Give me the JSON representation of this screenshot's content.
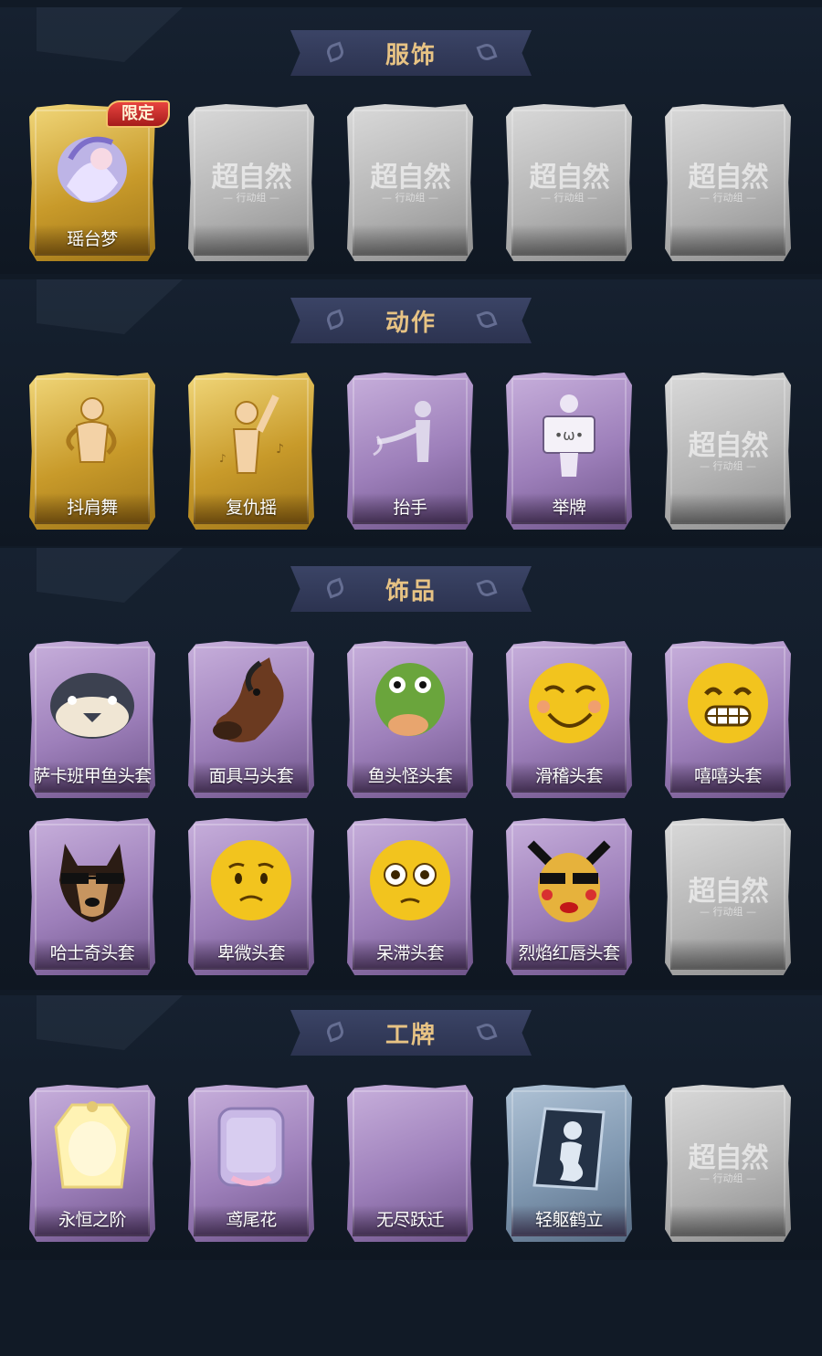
{
  "sections": [
    {
      "title": "服饰",
      "cards": [
        {
          "label": "瑶台梦",
          "rarity": "gold",
          "icon": "costume-portrait-icon",
          "badge": "限定"
        },
        {
          "label": "",
          "rarity": "gray",
          "icon": "locked-placeholder-icon",
          "locked_text": "超自然",
          "locked_sub": "— 行动组 —"
        },
        {
          "label": "",
          "rarity": "gray",
          "icon": "locked-placeholder-icon",
          "locked_text": "超自然",
          "locked_sub": "— 行动组 —"
        },
        {
          "label": "",
          "rarity": "gray",
          "icon": "locked-placeholder-icon",
          "locked_text": "超自然",
          "locked_sub": "— 行动组 —"
        },
        {
          "label": "",
          "rarity": "gray",
          "icon": "locked-placeholder-icon",
          "locked_text": "超自然",
          "locked_sub": "— 行动组 —"
        }
      ]
    },
    {
      "title": "动作",
      "cards": [
        {
          "label": "抖肩舞",
          "rarity": "gold",
          "icon": "shoulder-dance-pose-icon"
        },
        {
          "label": "复仇摇",
          "rarity": "gold",
          "icon": "revenge-shake-pose-icon"
        },
        {
          "label": "抬手",
          "rarity": "purple",
          "icon": "raise-hand-pose-icon"
        },
        {
          "label": "举牌",
          "rarity": "purple",
          "icon": "hold-sign-pose-icon"
        },
        {
          "label": "",
          "rarity": "gray",
          "icon": "locked-placeholder-icon",
          "locked_text": "超自然",
          "locked_sub": "— 行动组 —"
        }
      ]
    },
    {
      "title": "饰品",
      "cards": [
        {
          "label": "萨卡班甲鱼头套",
          "rarity": "purple",
          "icon": "fish-head-mask-icon"
        },
        {
          "label": "面具马头套",
          "rarity": "purple",
          "icon": "horse-head-mask-icon"
        },
        {
          "label": "鱼头怪头套",
          "rarity": "purple",
          "icon": "green-fish-mask-icon"
        },
        {
          "label": "滑稽头套",
          "rarity": "purple",
          "icon": "funny-smile-mask-icon"
        },
        {
          "label": "嘻嘻头套",
          "rarity": "purple",
          "icon": "grin-mask-icon"
        },
        {
          "label": "哈士奇头套",
          "rarity": "purple",
          "icon": "husky-mask-icon"
        },
        {
          "label": "卑微头套",
          "rarity": "purple",
          "icon": "humble-face-mask-icon"
        },
        {
          "label": "呆滞头套",
          "rarity": "purple",
          "icon": "dazed-face-mask-icon"
        },
        {
          "label": "烈焰红唇头套",
          "rarity": "purple",
          "icon": "red-lips-mask-icon"
        },
        {
          "label": "",
          "rarity": "gray",
          "icon": "locked-placeholder-icon",
          "locked_text": "超自然",
          "locked_sub": "— 行动组 —"
        }
      ]
    },
    {
      "title": "工牌",
      "cards": [
        {
          "label": "永恒之阶",
          "rarity": "purple",
          "icon": "golden-badge-icon"
        },
        {
          "label": "鸢尾花",
          "rarity": "purple",
          "icon": "iris-badge-icon"
        },
        {
          "label": "无尽跃迁",
          "rarity": "purple",
          "icon": "blank-badge-icon"
        },
        {
          "label": "轻躯鹤立",
          "rarity": "steel",
          "icon": "silhouette-badge-icon"
        },
        {
          "label": "",
          "rarity": "gray",
          "icon": "locked-placeholder-icon",
          "locked_text": "超自然",
          "locked_sub": "— 行动组 —"
        }
      ]
    }
  ],
  "colors": {
    "background": "#111a26",
    "banner": "#3b4466",
    "banner_text": "#e7c384",
    "gold": "#c89a2a",
    "purple": "#9d7fba",
    "gray": "#b5b5b5",
    "steel": "#7f97b0",
    "badge_red": "#c62d2d"
  }
}
